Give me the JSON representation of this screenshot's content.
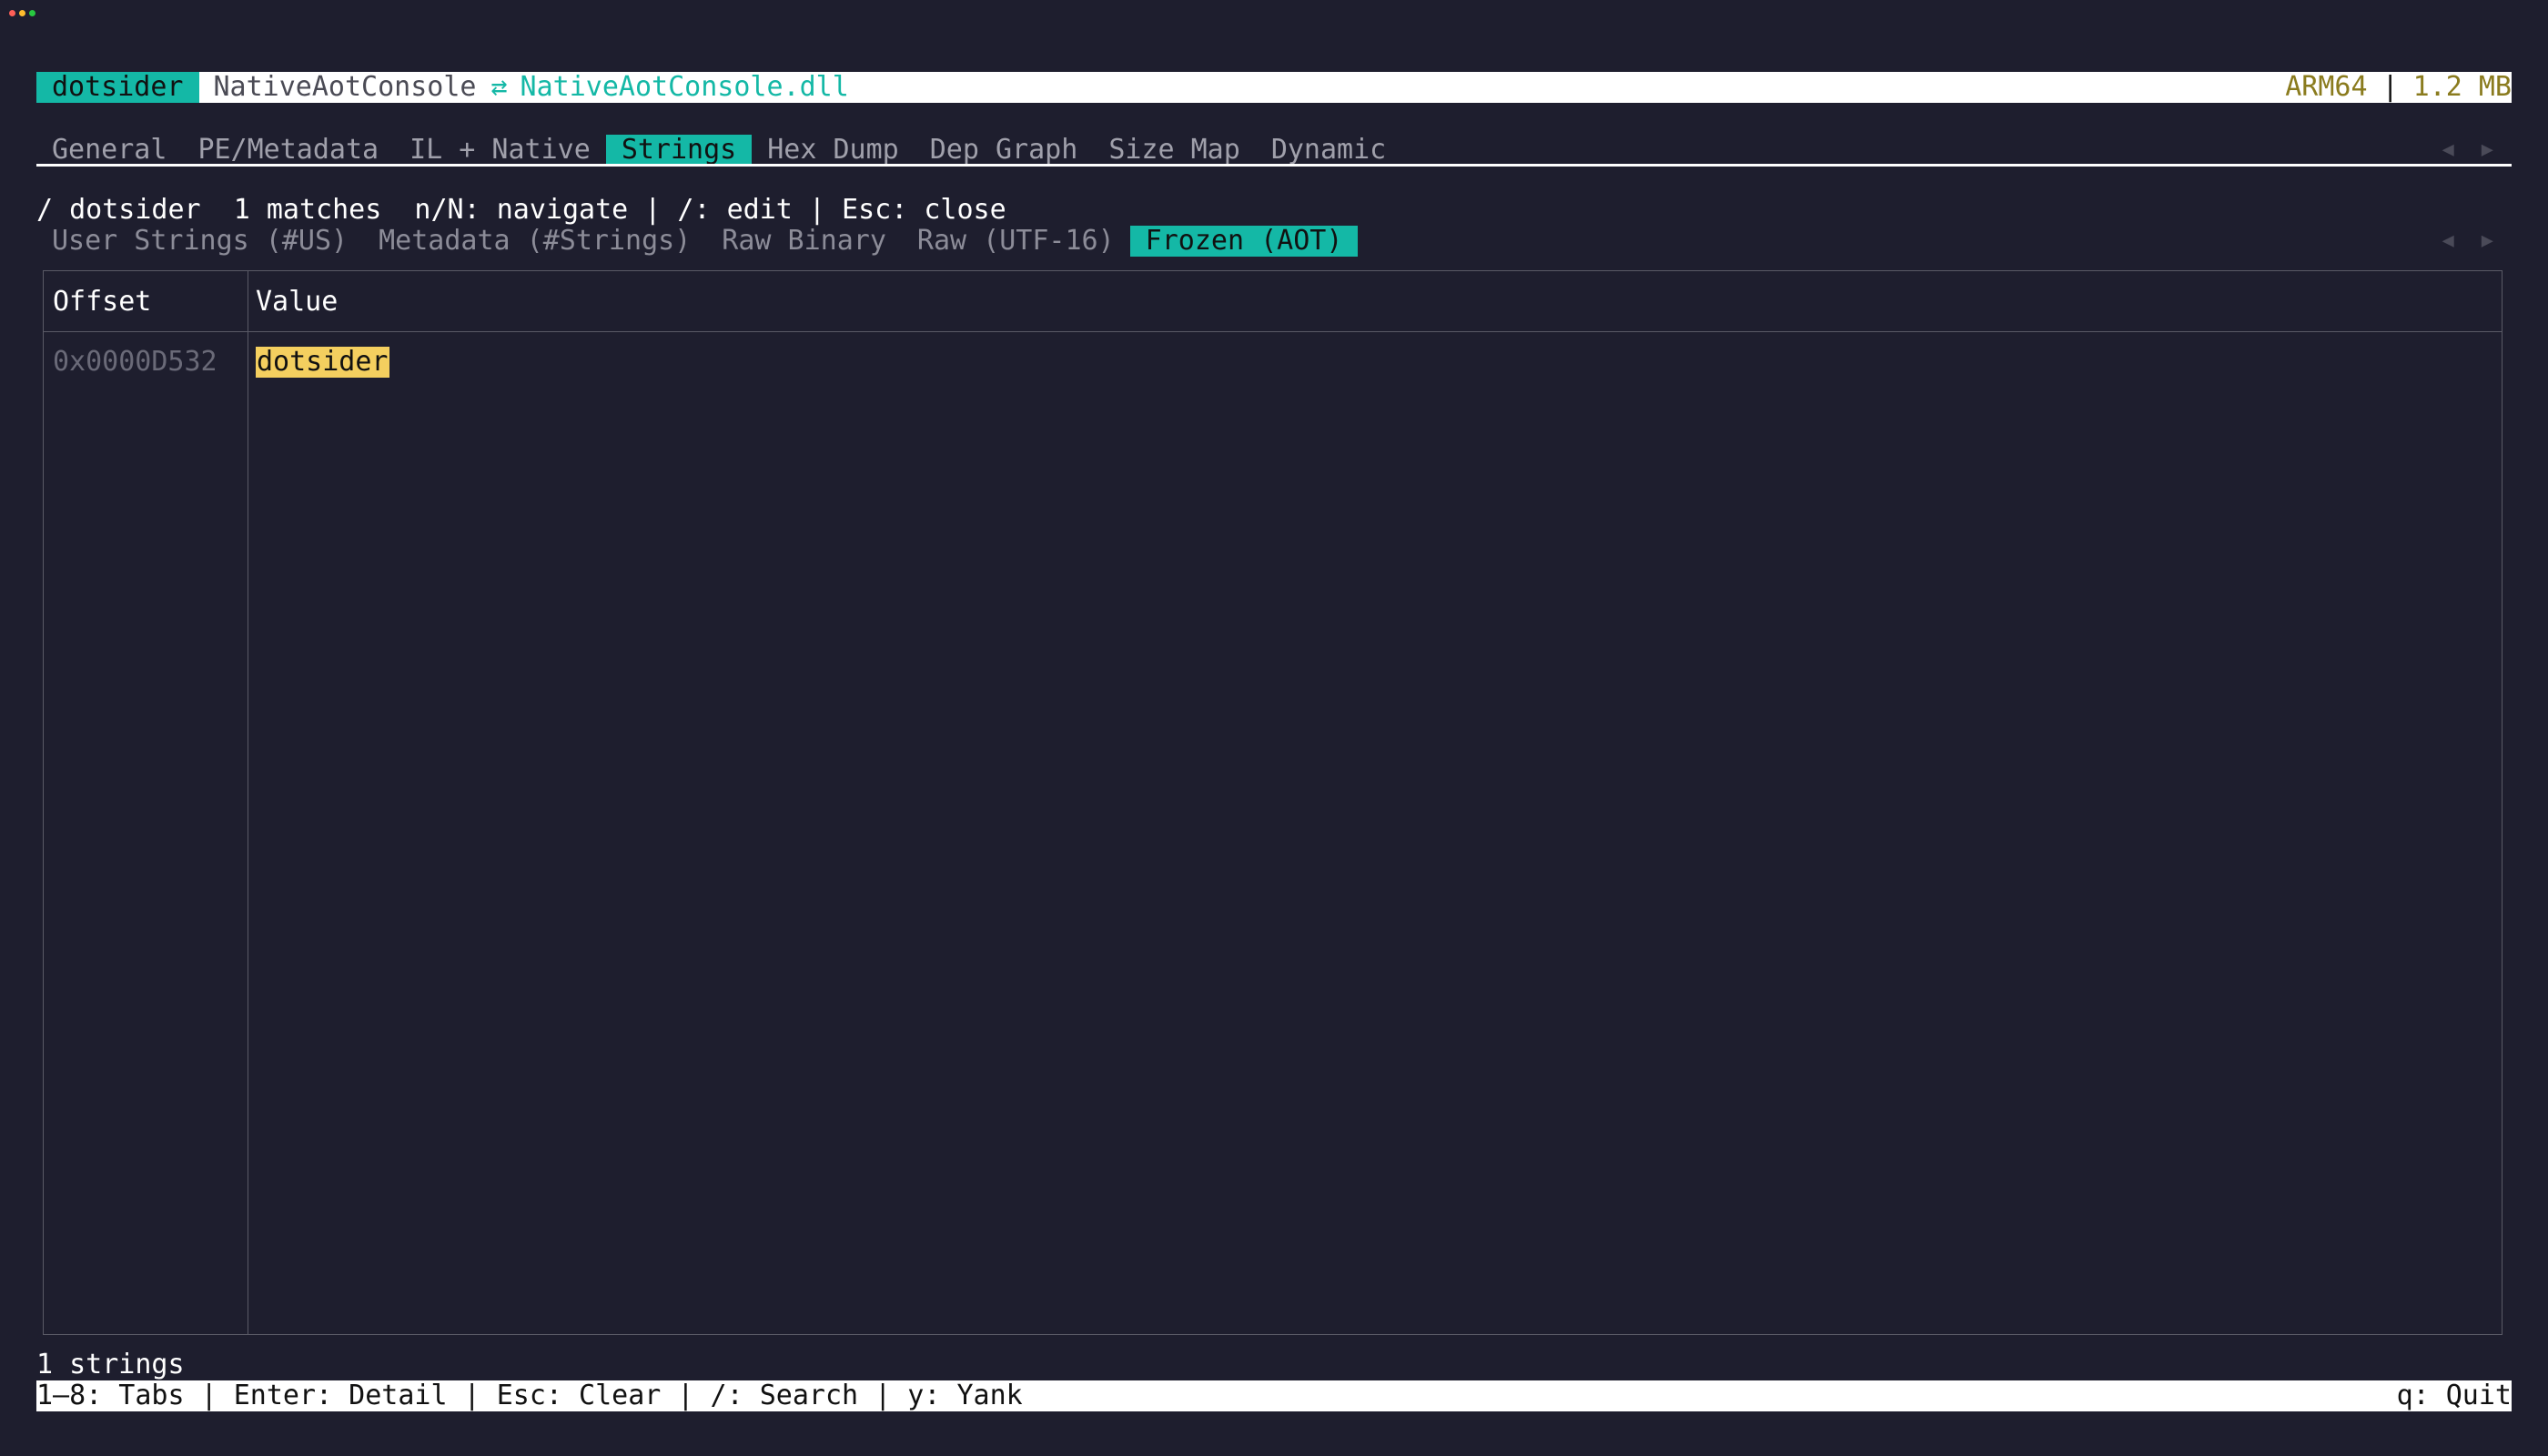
{
  "window": {
    "traffic_colors": [
      "#ff5f57",
      "#febc2e",
      "#28c840"
    ]
  },
  "titlebar": {
    "app": "dotsider",
    "file": "NativeAotConsole",
    "swap_icon": "⇄",
    "dll": "NativeAotConsole.dll",
    "arch": "ARM64",
    "separator": "|",
    "size": "1.2 MB"
  },
  "tabs": [
    "General",
    "PE/Metadata",
    "IL + Native",
    "Strings",
    "Hex Dump",
    "Dep Graph",
    "Size Map",
    "Dynamic"
  ],
  "active_tab": "Strings",
  "nav": {
    "prev": "◀",
    "next": "▶"
  },
  "search": {
    "line": "/ dotsider  1 matches  n/N: navigate | /: edit | Esc: close"
  },
  "subtabs": [
    "User Strings (#US)",
    "Metadata (#Strings)",
    "Raw Binary",
    "Raw (UTF-16)",
    "Frozen (AOT)"
  ],
  "active_subtab": "Frozen (AOT)",
  "table": {
    "columns": [
      "Offset",
      "Value"
    ],
    "rows": [
      {
        "offset": "0x0000D532",
        "value": "dotsider"
      }
    ]
  },
  "footer": {
    "count": "1 strings",
    "keys": "1–8: Tabs | Enter: Detail | Esc: Clear | /: Search | y: Yank",
    "quit": "q: Quit"
  }
}
